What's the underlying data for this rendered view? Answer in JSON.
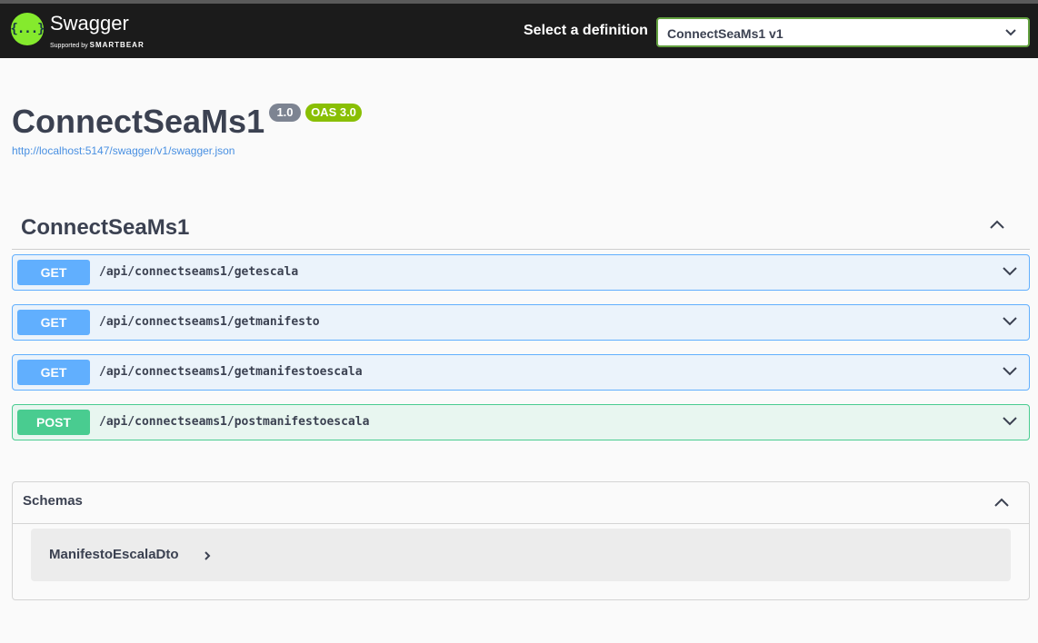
{
  "topbar": {
    "brand": "Swagger",
    "brand_sub_prefix": "Supported by",
    "brand_sub_name": "SMARTBEAR",
    "logo_glyph": "{...}",
    "definition_label": "Select a definition",
    "definition_value": "ConnectSeaMs1 v1",
    "colors": {
      "bar": "#1b1b1b",
      "logo": "#85ea2d",
      "select_border": "#62a03f"
    }
  },
  "info": {
    "title": "ConnectSeaMs1",
    "version": "1.0",
    "oas": "OAS 3.0",
    "spec_url": "http://localhost:5147/swagger/v1/swagger.json"
  },
  "tag": {
    "name": "ConnectSeaMs1",
    "icon": "chevron-up-icon"
  },
  "operations": [
    {
      "method": "GET",
      "path": "/api/connectseams1/getescala",
      "color": "#61affe"
    },
    {
      "method": "GET",
      "path": "/api/connectseams1/getmanifesto",
      "color": "#61affe"
    },
    {
      "method": "GET",
      "path": "/api/connectseams1/getmanifestoescala",
      "color": "#61affe"
    },
    {
      "method": "POST",
      "path": "/api/connectseams1/postmanifestoescala",
      "color": "#49cc90"
    }
  ],
  "schemas": {
    "title": "Schemas",
    "models": [
      {
        "name": "ManifestoEscalaDto"
      }
    ]
  }
}
